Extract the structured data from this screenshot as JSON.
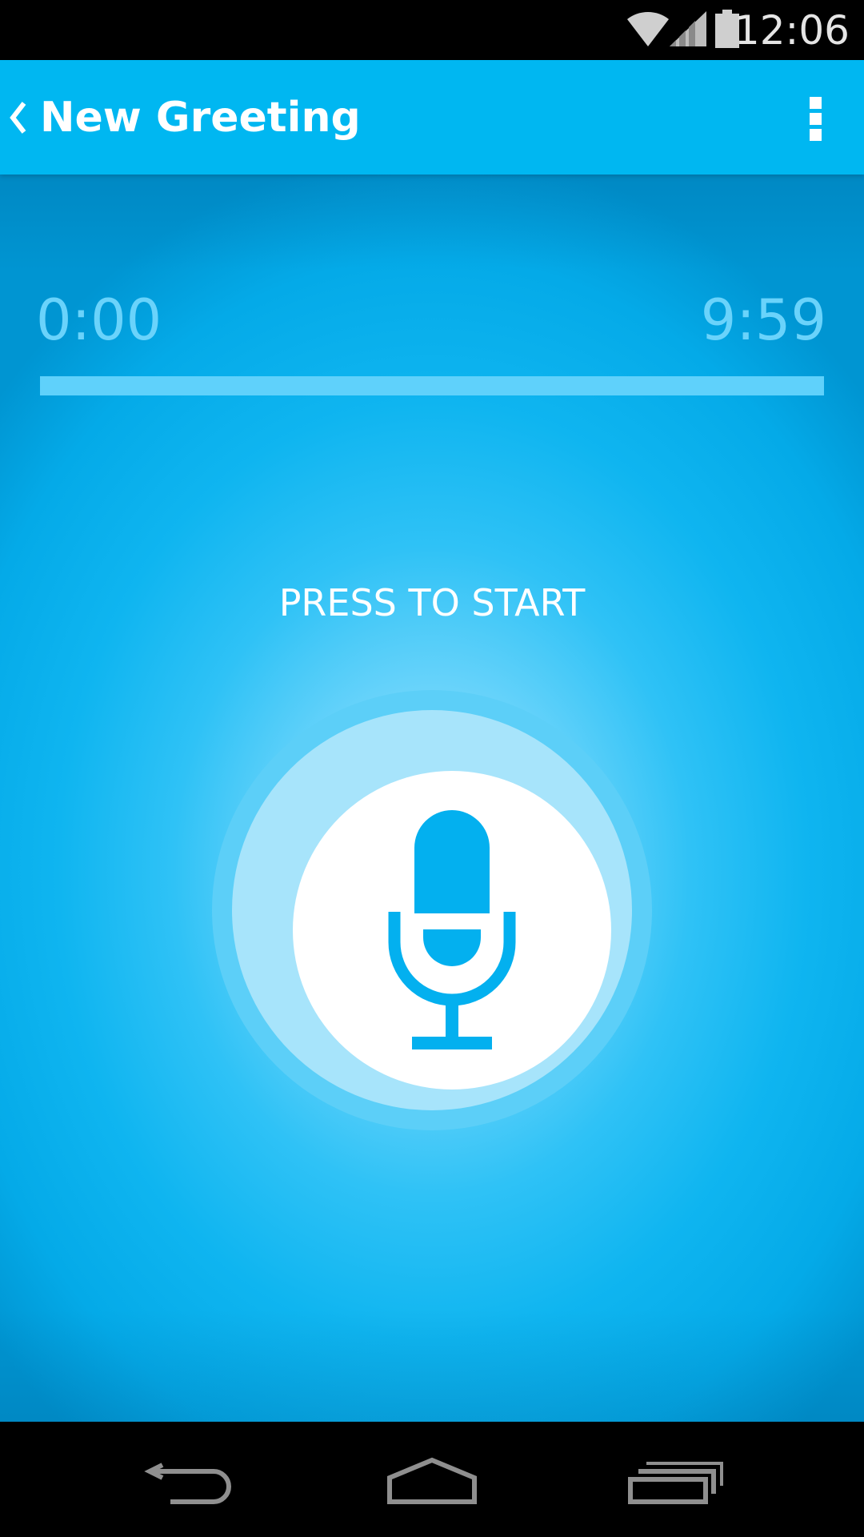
{
  "status_bar": {
    "time": "12:06",
    "icons": [
      "wifi-icon",
      "cell-signal-icon",
      "battery-icon"
    ]
  },
  "header": {
    "title": "New Greeting",
    "back_icon": "chevron-left-icon",
    "menu_icon": "overflow-menu-icon"
  },
  "recorder": {
    "elapsed": "0:00",
    "max_duration": "9:59",
    "progress": 0,
    "prompt": "PRESS TO START",
    "button_icon": "microphone-icon"
  },
  "nav_bar": {
    "buttons": [
      "back-icon",
      "home-icon",
      "recents-icon"
    ]
  },
  "colors": {
    "accent": "#00b7f1",
    "timer_text": "#6ad3fb",
    "mic": "#03b0ef",
    "ring_outer": "#5ccff8",
    "ring_inner": "#a7e4fb"
  }
}
